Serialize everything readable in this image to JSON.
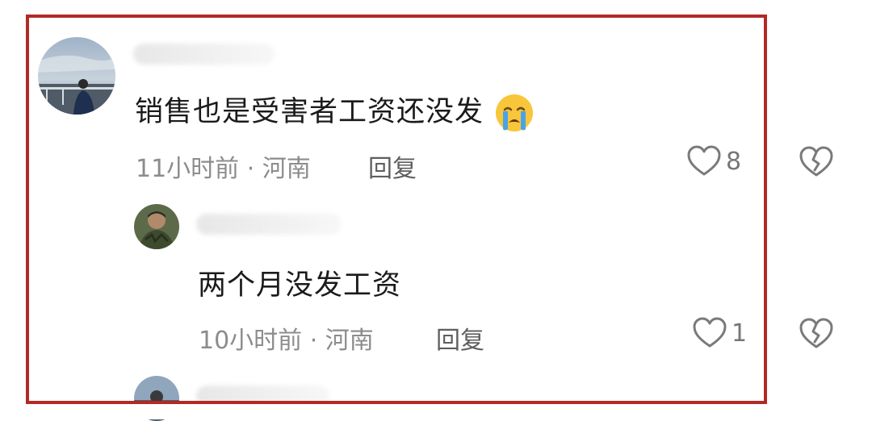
{
  "comment": {
    "text": "销售也是受害者工资还没发",
    "emoji": "loudly-crying-face",
    "meta": "11小时前 · 河南",
    "reply_label": "回复",
    "likes": "8"
  },
  "reply_comment": {
    "text": "两个月没发工资",
    "meta": "10小时前 · 河南",
    "reply_label": "回复",
    "likes": "1"
  },
  "colors": {
    "frame": "#b22a24",
    "text": "#1b1b1b",
    "meta": "#8c8c8c"
  }
}
